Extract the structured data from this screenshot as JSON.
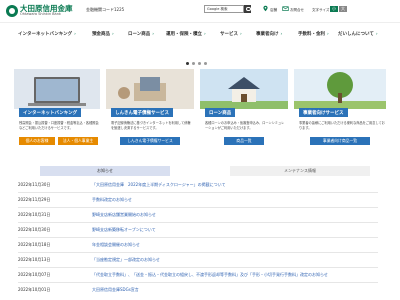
{
  "header": {
    "logo_name": "大田原信用金庫",
    "logo_sub": "Ohtawara Shinkin Bank",
    "bank_code": "金融機関コード1225",
    "search_value": "Google 検索",
    "store_label": "店舗",
    "qa_label": "お問合せ",
    "fontsize_label": "文字サイズ",
    "fs_small": "小",
    "fs_large": "大"
  },
  "nav": {
    "items": [
      {
        "label": "インターネットバンキング"
      },
      {
        "label": "預金商品"
      },
      {
        "label": "ローン商品"
      },
      {
        "label": "運用・保険・積立"
      },
      {
        "label": "サービス"
      },
      {
        "label": "事業者向け"
      },
      {
        "label": "手数料・金利"
      },
      {
        "label": "だいしんについて"
      }
    ]
  },
  "cards": [
    {
      "title": "インターネットバンキング",
      "desc": "残高照会・振込振替・口座振替・税金等払込・各種照会などご利用いただけるサービスです。",
      "btn1": "個人のお客様",
      "btn2": "法人・個人事業主"
    },
    {
      "title": "しんきん電子債権サービス",
      "desc": "電子記録債権法に基づきインターネットを利用して債権を譲渡し決済するサービスです。",
      "btn1": "しんきん電子債権サービス"
    },
    {
      "title": "ローン商品",
      "desc": "各種ローンのお申込み・仮審査申込み、ローンシミュレーションがご利用いただけます。",
      "btn1": "商品一覧"
    },
    {
      "title": "事業者向けサービス",
      "desc": "事業者の皆様にご利用いただける便利な商品をご用意しております。",
      "btn1": "事業者向け商品一覧"
    }
  ],
  "tabs": {
    "news": "お知らせ",
    "maintenance": "メンテナンス情報"
  },
  "news": [
    {
      "date": "2022年11月30日",
      "title": "「大田原信用金庫　2022年度上半期ディスクロージャー」の掲載について"
    },
    {
      "date": "2022年11月29日",
      "title": "手数料改定のお知らせ"
    },
    {
      "date": "2022年10月31日",
      "title": "野崎支店新店舗営業開始のお知らせ"
    },
    {
      "date": "2022年10月30日",
      "title": "野崎支店新築移転オープンについて"
    },
    {
      "date": "2022年10月18日",
      "title": "年金相談会開催のお知らせ"
    },
    {
      "date": "2022年10月13日",
      "title": "「当座勘定規定」一部改定のお知らせ"
    },
    {
      "date": "2022年10月07日",
      "title": "「代金取立手数料」、「送金・振込・代金取立の組戻し、不渡手形返却等手数料」及び「手形・小切手発行手数料」改定のお知らせ"
    },
    {
      "date": "2022年10月01日",
      "title": "大田原信用金庫SDGs宣言"
    }
  ],
  "colors": {
    "brand_green": "#0a7a52",
    "brand_blue": "#2b72b8",
    "orange": "#e68a00"
  }
}
